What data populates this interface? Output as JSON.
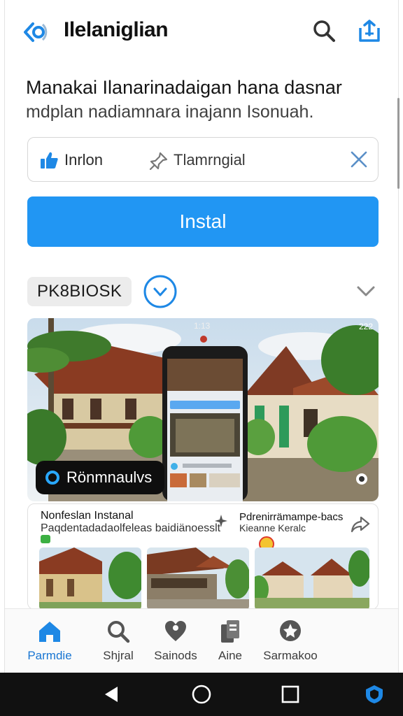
{
  "header": {
    "title": "Ilelaniglian"
  },
  "intro": {
    "headline": "Manakai Ilanarinadaigan hana dasnar",
    "subline": "mdplan nadiamnara inajann Isonuah."
  },
  "actions": {
    "like_label": "Inrlon",
    "pin_label": "Tlamrngial"
  },
  "install": {
    "label": "Instal"
  },
  "section": {
    "chip_label": "PK8BIOSK"
  },
  "hero": {
    "badge_label": "Rönmnaulvs",
    "time": "1:13",
    "status": "222"
  },
  "recommendations": {
    "left_title": "Nonfeslan Instanal",
    "left_subtitle": "Paqdentadadaolfeleas  baidiänoesslt",
    "right_title": "Pdrenirrämampe-bacs",
    "right_subtitle": "Kieanne Keralc"
  },
  "bottom_nav": {
    "items": [
      {
        "label": "Parmdie",
        "icon": "home-icon",
        "active": true
      },
      {
        "label": "Shjral",
        "icon": "search-icon",
        "active": false
      },
      {
        "label": "Sainods",
        "icon": "heart-pin-icon",
        "active": false
      },
      {
        "label": "Aine",
        "icon": "documents-icon",
        "active": false
      },
      {
        "label": "Sarmakoo",
        "icon": "star-badge-icon",
        "active": false
      }
    ]
  },
  "colors": {
    "accent": "#2196f3",
    "active_nav": "#1976d2",
    "system_bar": "#111111"
  }
}
